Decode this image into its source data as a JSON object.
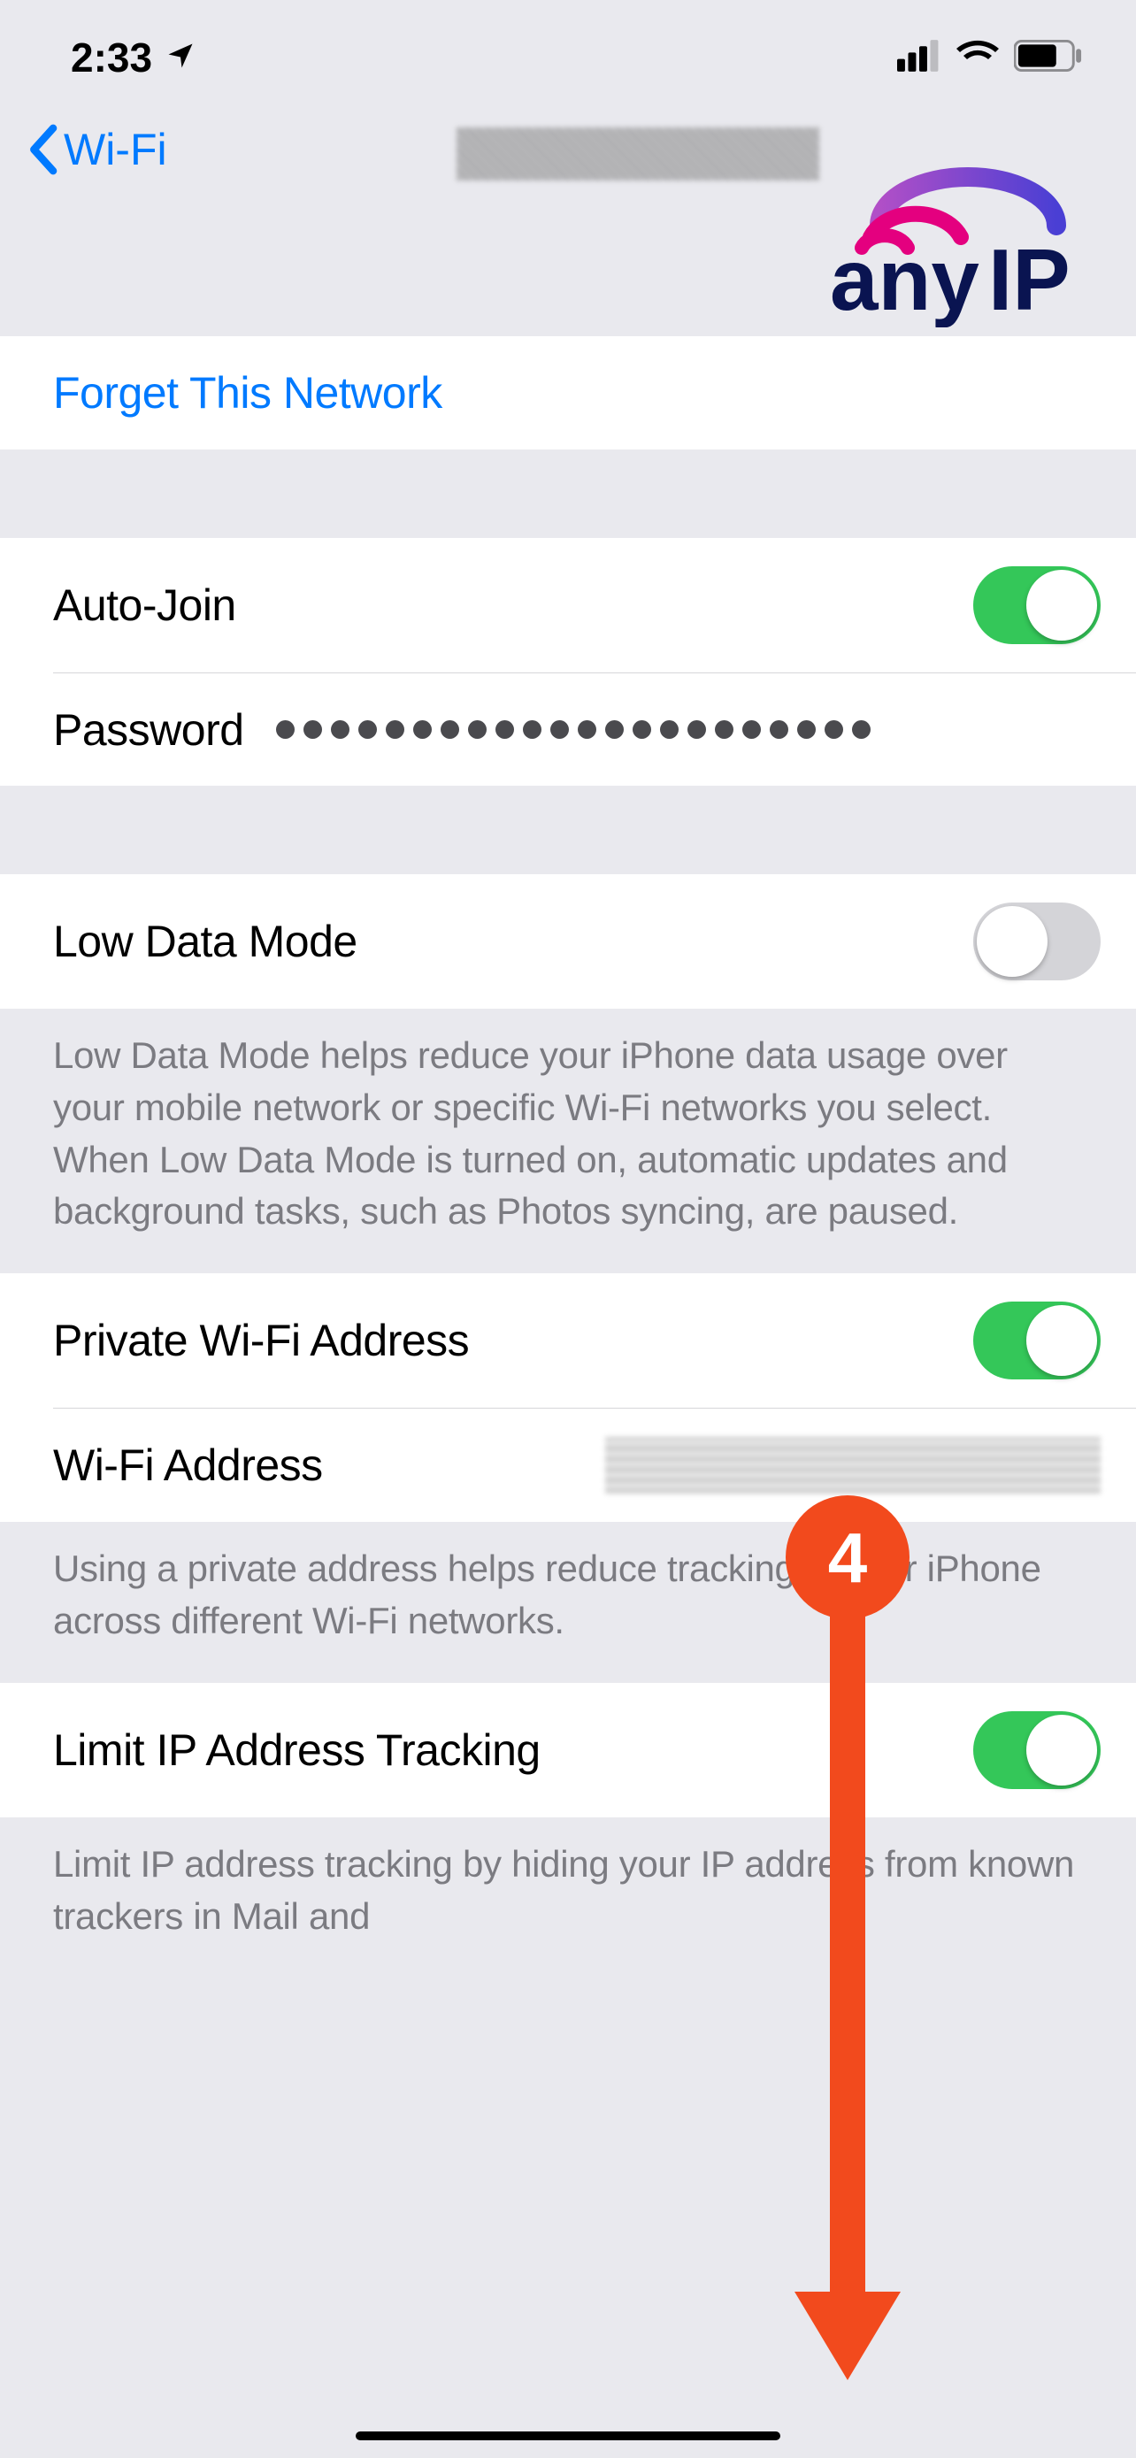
{
  "status": {
    "time": "2:33"
  },
  "nav": {
    "back_label": "Wi-Fi"
  },
  "logo": {
    "text": "anyIP"
  },
  "forget": {
    "label": "Forget This Network"
  },
  "autojoin": {
    "label": "Auto-Join",
    "on": true
  },
  "password": {
    "label": "Password",
    "dot_count": 22
  },
  "lowdata": {
    "label": "Low Data Mode",
    "on": false,
    "footer": "Low Data Mode helps reduce your iPhone data usage over your mobile network or specific Wi-Fi networks you select. When Low Data Mode is turned on, automatic updates and background tasks, such as Photos syncing, are paused."
  },
  "private": {
    "label": "Private Wi-Fi Address",
    "on": true,
    "addr_label": "Wi-Fi Address",
    "footer": "Using a private address helps reduce tracking of your iPhone across different Wi-Fi networks."
  },
  "limit": {
    "label": "Limit IP Address Tracking",
    "on": true,
    "footer": "Limit IP address tracking by hiding your IP address from known trackers in Mail and"
  },
  "annotation": {
    "number": "4"
  }
}
